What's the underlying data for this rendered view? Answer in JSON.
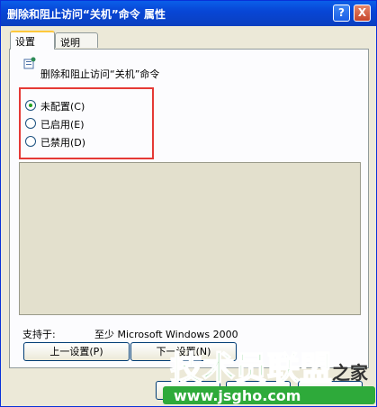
{
  "window": {
    "title": "删除和阻止访问“关机”命令 属性",
    "help_label": "?",
    "close_label": "X"
  },
  "tabs": [
    {
      "label": "设置"
    },
    {
      "label": "说明"
    }
  ],
  "policy": {
    "title": "删除和阻止访问“关机”命令"
  },
  "radio_options": [
    {
      "label": "未配置(C)",
      "selected": true
    },
    {
      "label": "已启用(E)",
      "selected": false
    },
    {
      "label": "已禁用(D)",
      "selected": false
    }
  ],
  "supported": {
    "label": "支持于:",
    "value": "至少 Microsoft Windows 2000"
  },
  "buttons": {
    "prev": "上一设置(P)",
    "next": "下一设置(N)"
  },
  "watermark": {
    "text": "技术员联盟",
    "url": "www.jsgho.com",
    "suffix": "之家"
  },
  "colors": {
    "titlebar": "#0a46d6",
    "highlight_box": "#e53935",
    "watermark_blue": "#1565c0"
  }
}
